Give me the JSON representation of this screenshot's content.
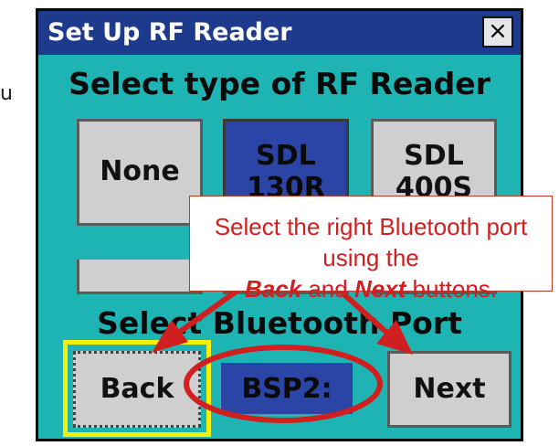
{
  "stray_text": "u",
  "window": {
    "title": "Set Up RF Reader",
    "close_glyph": "×"
  },
  "reader_section": {
    "heading": "Select type of RF Reader",
    "options": [
      {
        "label": "None",
        "selected": false
      },
      {
        "label": "SDL\n130R",
        "selected": true
      },
      {
        "label": "SDL\n400S",
        "selected": false
      }
    ]
  },
  "port_section": {
    "heading": "Select Bluetooth Port",
    "back_label": "Back",
    "next_label": "Next",
    "current_port": "BSP2:"
  },
  "callout": {
    "line1": "Select the right Bluetooth port using the",
    "back_word": "Back",
    "and_word": " and ",
    "next_word": "Next",
    "tail": " buttons."
  },
  "colors": {
    "window_bg": "#1fb4b4",
    "titlebar": "#1d3a8c",
    "selected_button": "#2b45a6",
    "focus_ring": "#f7ee0b",
    "annotation_red": "#d11f1f"
  }
}
